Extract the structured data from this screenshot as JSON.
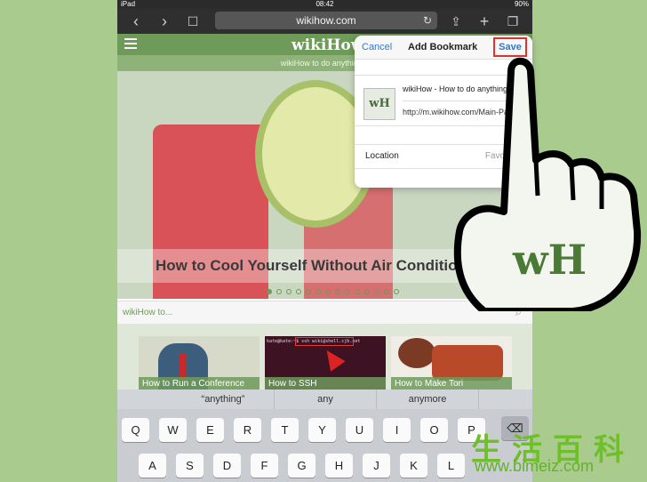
{
  "status": {
    "carrier": "iPad",
    "time": "08:42",
    "battery": "90%"
  },
  "browser": {
    "url": "wikihow.com",
    "back_icon": "chevron-left",
    "forward_icon": "chevron-right",
    "bookmarks_icon": "book",
    "share_icon": "share",
    "add_icon": "plus",
    "tabs_icon": "tabs"
  },
  "site": {
    "logo": "wikiHow",
    "tagline": "wikiHow to do anything...",
    "hero_title": "How to Cool Yourself Without Air Conditioning",
    "search_placeholder": "wikiHow to...",
    "thumb_captions": [
      "How to Run a Conference",
      "How to SSH",
      "How to Make Tori"
    ],
    "terminal_text": "kate@kate:~$ ssh wiki@shell.cjb.net"
  },
  "keyboard": {
    "predictions": [
      "“anything”",
      "any",
      "anymore"
    ],
    "row1": [
      "Q",
      "W",
      "E",
      "R",
      "T",
      "Y",
      "U",
      "I",
      "O",
      "P"
    ],
    "row2": [
      "A",
      "S",
      "D",
      "F",
      "G",
      "H",
      "J",
      "K",
      "L"
    ]
  },
  "bookmark": {
    "cancel": "Cancel",
    "title": "Add Bookmark",
    "save": "Save",
    "thumb": "wH",
    "name": "wikiHow - How to do anything",
    "url": "http://m.wikihow.com/Main-Page",
    "location_label": "Location",
    "location_value": "Favorites"
  },
  "hand_overlay": {
    "logo": "wH"
  },
  "watermark": {
    "chars": "生活百科",
    "url": "www.bimeiz.com"
  },
  "colors": {
    "brand_green": "#6e9a5a",
    "highlight_red": "#e0312a",
    "ios_blue": "#3078d0"
  }
}
